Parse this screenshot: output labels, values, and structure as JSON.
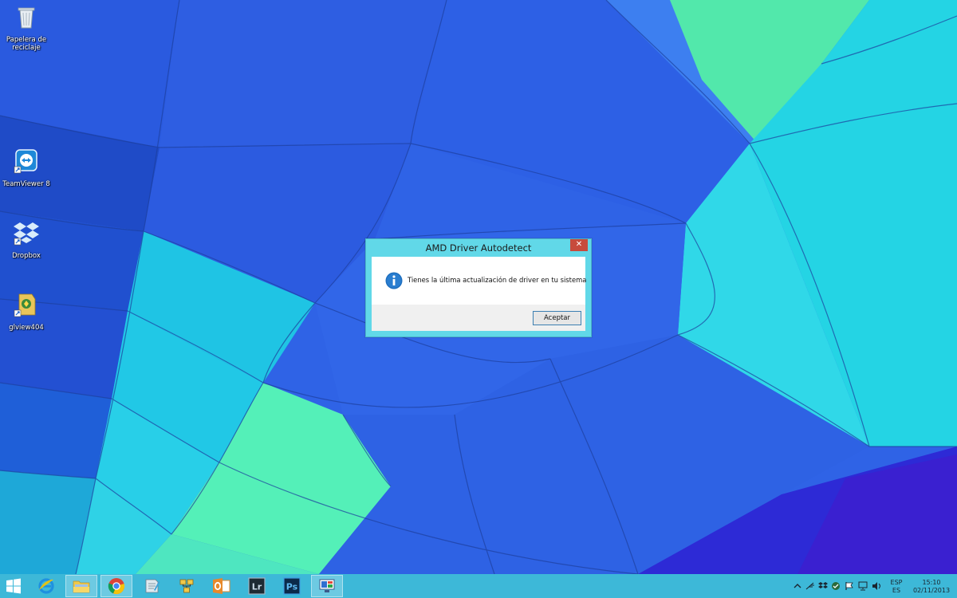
{
  "desktop": {
    "icons": [
      {
        "label_line1": "Papelera de",
        "label_line2": "reciclaje",
        "icon": "recycle-bin-icon"
      },
      {
        "label": "TeamViewer 8",
        "icon": "teamviewer-icon"
      },
      {
        "label": "Dropbox",
        "icon": "dropbox-icon"
      },
      {
        "label": "glview404",
        "icon": "glview-icon"
      }
    ]
  },
  "dialog": {
    "title": "AMD Driver Autodetect",
    "close_glyph": "✕",
    "message": "Tienes la última actualización de driver en tu sistema",
    "ok_label": "Aceptar",
    "icon": "info-icon"
  },
  "taskbar": {
    "start_icon": "windows-start-icon",
    "apps": [
      {
        "name": "internet-explorer",
        "icon": "internet-explorer-icon"
      },
      {
        "name": "file-explorer",
        "icon": "folder-icon"
      },
      {
        "name": "chrome",
        "icon": "chrome-icon"
      },
      {
        "name": "notes",
        "icon": "notepad-icon"
      },
      {
        "name": "network-tool",
        "icon": "network-icon"
      },
      {
        "name": "outlook",
        "icon": "outlook-icon"
      },
      {
        "name": "lightroom",
        "icon": "lightroom-icon",
        "text": "Lr"
      },
      {
        "name": "photoshop",
        "icon": "photoshop-icon",
        "text": "Ps"
      },
      {
        "name": "amd-autodetect",
        "icon": "amd-autodetect-icon"
      }
    ],
    "tray": {
      "language_top": "ESP",
      "language_bottom": "ES",
      "time": "15:10",
      "date": "02/11/2013"
    }
  },
  "colors": {
    "taskbar": "#40c4d6",
    "dialog_frame": "#61d8e8",
    "close_button": "#c74b3c",
    "info_icon": "#1e6fbf"
  }
}
